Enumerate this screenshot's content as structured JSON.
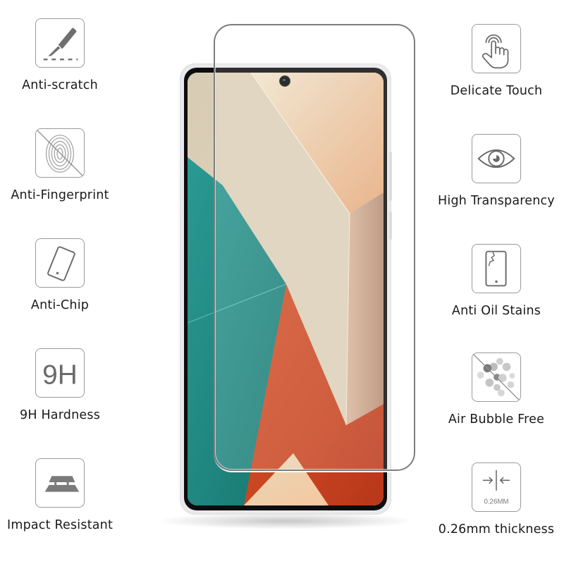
{
  "left_features": [
    {
      "label": "Anti-scratch",
      "icon": "scalpel-scratch-icon"
    },
    {
      "label": "Anti-Fingerprint",
      "icon": "fingerprint-crossed-icon"
    },
    {
      "label": "Anti-Chip",
      "icon": "tilted-phone-icon"
    },
    {
      "label": "9H Hardness",
      "icon": "9h-badge-icon",
      "icon_text": "9H"
    },
    {
      "label": "Impact Resistant",
      "icon": "layered-plates-icon"
    }
  ],
  "right_features": [
    {
      "label": "Delicate Touch",
      "icon": "touch-hand-icon"
    },
    {
      "label": "High Transparency",
      "icon": "eye-icon"
    },
    {
      "label": "Anti Oil Stains",
      "icon": "cracked-phone-icon"
    },
    {
      "label": "Air Bubble Free",
      "icon": "bubbles-crossed-icon"
    },
    {
      "label": "0.26mm thickness",
      "icon": "thickness-arrows-icon",
      "icon_text": "0.26MM"
    }
  ],
  "colors": {
    "icon_stroke": "#7a7a7a",
    "wallpaper_teal": "#1f8c86",
    "wallpaper_orange": "#c8461f",
    "wallpaper_cream": "#e6d8bf"
  }
}
